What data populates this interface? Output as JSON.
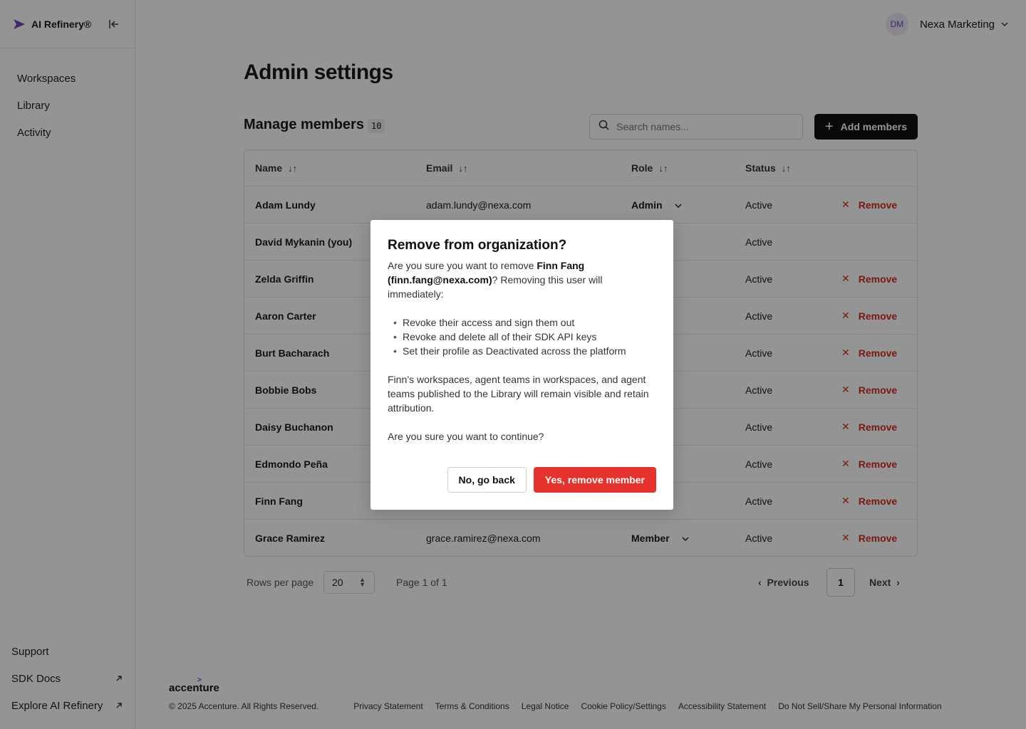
{
  "app": {
    "name": "AI Refinery®"
  },
  "sidebar": {
    "items": [
      {
        "label": "Workspaces"
      },
      {
        "label": "Library"
      },
      {
        "label": "Activity"
      }
    ],
    "bottom": [
      {
        "label": "Support",
        "icon": ""
      },
      {
        "label": "SDK Docs",
        "icon": "external-link-icon"
      },
      {
        "label": "Explore AI Refinery",
        "icon": "external-link-icon"
      }
    ]
  },
  "account": {
    "initials": "DM",
    "name": "Nexa Marketing"
  },
  "page": {
    "title": "Admin settings"
  },
  "members": {
    "title": "Manage members",
    "count": "10",
    "search_placeholder": "Search names...",
    "add_label": "Add members",
    "columns": [
      "Name",
      "Email",
      "Role",
      "Status"
    ],
    "rows": [
      {
        "name": "Adam Lundy",
        "email": "adam.lundy@nexa.com",
        "role": "Admin",
        "status": "Active",
        "action": "Remove"
      },
      {
        "name": "David Mykanin (you)",
        "email": "",
        "role": "",
        "status": "Active",
        "action": ""
      },
      {
        "name": "Zelda Griffin",
        "email": "",
        "role": "",
        "status": "Active",
        "action": "Remove"
      },
      {
        "name": "Aaron Carter",
        "email": "",
        "role": "",
        "status": "Active",
        "action": "Remove"
      },
      {
        "name": "Burt Bacharach",
        "email": "",
        "role": "",
        "status": "Active",
        "action": "Remove"
      },
      {
        "name": "Bobbie Bobs",
        "email": "",
        "role": "",
        "status": "Active",
        "action": "Remove"
      },
      {
        "name": "Daisy Buchanon",
        "email": "",
        "role": "",
        "status": "Active",
        "action": "Remove"
      },
      {
        "name": "Edmondo Peña",
        "email": "",
        "role": "",
        "status": "Active",
        "action": "Remove"
      },
      {
        "name": "Finn Fang",
        "email": "",
        "role": "",
        "status": "Active",
        "action": "Remove"
      },
      {
        "name": "Grace Ramirez",
        "email": "grace.ramirez@nexa.com",
        "role": "Member",
        "status": "Active",
        "action": "Remove"
      }
    ]
  },
  "pagination": {
    "rows_label": "Rows per page",
    "rows_value": "20",
    "page_info": "Page 1 of 1",
    "previous": "Previous",
    "current": "1",
    "next": "Next"
  },
  "footer": {
    "logo": "accenture",
    "copyright": "© 2025 Accenture. All Rights Reserved.",
    "links": [
      "Privacy Statement",
      "Terms & Conditions",
      "Legal Notice",
      "Cookie Policy/Settings",
      "Accessibility Statement",
      "Do Not Sell/Share My Personal Information"
    ]
  },
  "modal": {
    "title": "Remove from organization?",
    "intro_pre": "Are you sure you want to remove ",
    "intro_bold": "Finn Fang (finn.fang@nexa.com)",
    "intro_post": "? Removing this user will immediately:",
    "bullets": [
      "Revoke their access and sign them out",
      "Revoke and delete all of their SDK API keys",
      "Set their profile as Deactivated across the platform"
    ],
    "note": "Finn’s workspaces, agent teams in workspaces, and agent teams published to the Library will remain visible and retain attribution.",
    "confirm": "Are you sure you want to continue?",
    "cancel_label": "No, go back",
    "confirm_label": "Yes, remove member"
  },
  "colors": {
    "accent": "#6f42c1",
    "danger": "#e5322d",
    "primary": "#111111"
  }
}
